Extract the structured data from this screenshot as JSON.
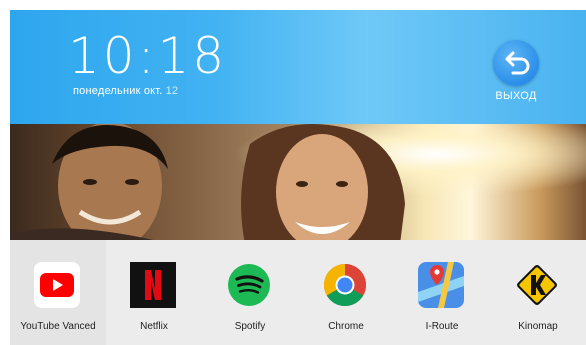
{
  "header": {
    "time": "10:18",
    "date_prefix": "понедельник окт.",
    "date_day": "12",
    "exit_label": "ВЫХОД"
  },
  "dock": {
    "apps": [
      {
        "label": "YouTube Vanced",
        "icon": "youtube-icon"
      },
      {
        "label": "Netflix",
        "icon": "netflix-icon"
      },
      {
        "label": "Spotify",
        "icon": "spotify-icon"
      },
      {
        "label": "Chrome",
        "icon": "chrome-icon"
      },
      {
        "label": "I-Route",
        "icon": "map-icon"
      },
      {
        "label": "Kinomap",
        "icon": "kinomap-icon"
      }
    ]
  },
  "colors": {
    "header_blue": "#2ea6ee",
    "youtube_red": "#ff0000",
    "netflix_red": "#e50914",
    "spotify_green": "#1db954",
    "kinomap_yellow": "#f7c600"
  }
}
